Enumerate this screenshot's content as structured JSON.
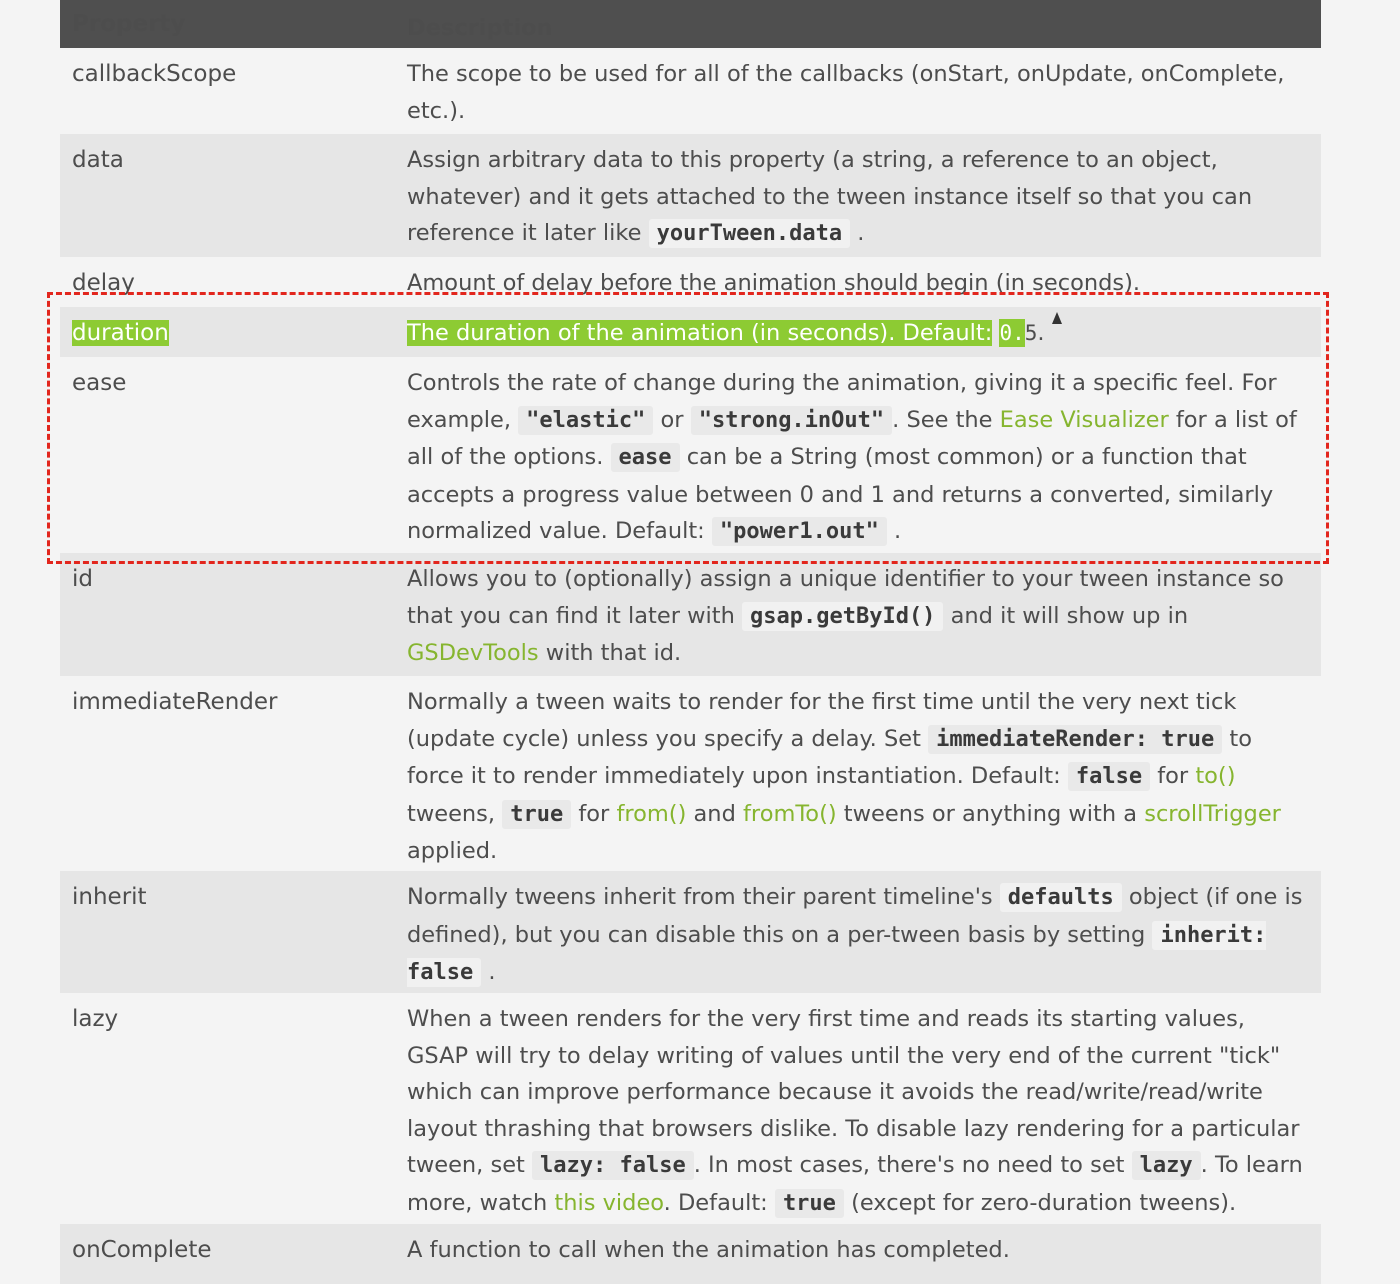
{
  "table": {
    "headers": {
      "property": "Property",
      "description": "Description"
    },
    "rows": [
      {
        "name": "callbackScope",
        "parts": [
          "The scope to be used for all of the callbacks (onStart, onUpdate, onComplete, etc.)."
        ]
      },
      {
        "name": "data",
        "parts": [
          "Assign arbitrary data to this property (a string, a reference to an object, whatever) and it gets attached to the tween instance itself so that you can reference it later like",
          "yourTween.data",
          "."
        ]
      },
      {
        "name": "delay",
        "parts": [
          "Amount of delay before the animation should begin (in seconds)."
        ]
      },
      {
        "name": "duration",
        "parts": [
          "The duration of the animation (in seconds). Default:",
          "0.",
          "5",
          "."
        ]
      },
      {
        "name": "ease",
        "parts": [
          "Controls the rate of change during the animation, giving it a specific feel. For example,",
          "\"elastic\"",
          "or",
          "\"strong.inOut\"",
          ". See the",
          "Ease Visualizer",
          "for a list of all of the options.",
          "ease",
          "can be a String (most common) or a function that accepts a progress value between 0 and 1 and returns a converted, similarly normalized value. Default:",
          "\"power1.out\"",
          "."
        ]
      },
      {
        "name": "id",
        "parts": [
          "Allows you to (optionally) assign a unique identifier to your tween instance so that you can find it later with",
          "gsap.getById()",
          "and it will show up in",
          "GSDevTools",
          "with that id."
        ]
      },
      {
        "name": "immediateRender",
        "parts": [
          "Normally a tween waits to render for the first time until the very next tick (update cycle) unless you specify a delay. Set",
          "immediateRender: true",
          "to force it to render immediately upon instantiation. Default:",
          "false",
          "for",
          "to()",
          "tweens,",
          "true",
          "for",
          "from()",
          "and",
          "fromTo()",
          "tweens or anything with a",
          "scrollTrigger",
          "applied."
        ]
      },
      {
        "name": "inherit",
        "parts": [
          "Normally tweens inherit from their parent timeline's",
          "defaults",
          "object (if one is defined), but you can disable this on a per-tween basis by setting",
          "inherit: false",
          "."
        ]
      },
      {
        "name": "lazy",
        "parts": [
          "When a tween renders for the very first time and reads its starting values, GSAP will try to delay writing of values until the very end of the current \"tick\" which can improve performance because it avoids the read/write/read/write layout thrashing that browsers dislike. To disable lazy rendering for a particular tween, set",
          "lazy: false",
          ". In most cases, there's no need to set",
          "lazy",
          ". To learn more, watch",
          "this video",
          ". Default:",
          "true",
          "(except for zero-duration tweens)."
        ]
      },
      {
        "name": "onComplete",
        "parts": [
          "A function to call when the animation has completed."
        ]
      }
    ]
  },
  "highlight_color": "#8dcb33",
  "link_color": "#86b52f",
  "annotation_color": "#e2261d"
}
